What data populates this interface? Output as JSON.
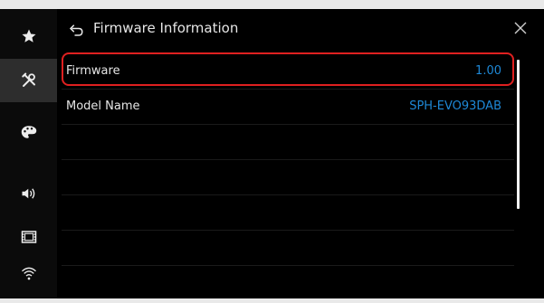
{
  "header": {
    "title": "Firmware Information"
  },
  "sidebar": {
    "items": [
      {
        "name": "favorites",
        "icon": "star-icon"
      },
      {
        "name": "settings",
        "icon": "tools-icon",
        "active": true
      },
      {
        "name": "theme",
        "icon": "palette-icon"
      },
      {
        "name": "audio",
        "icon": "speaker-icon"
      },
      {
        "name": "video",
        "icon": "film-icon"
      },
      {
        "name": "wireless",
        "icon": "wifi-icon"
      }
    ]
  },
  "rows": [
    {
      "label": "Firmware",
      "value": "1.00"
    },
    {
      "label": "Model Name",
      "value": "SPH-EVO93DAB"
    },
    {
      "label": "",
      "value": ""
    },
    {
      "label": "",
      "value": ""
    },
    {
      "label": "",
      "value": ""
    },
    {
      "label": "",
      "value": ""
    }
  ],
  "colors": {
    "value_text": "#1e88d6",
    "highlight": "#e02020",
    "active_sidebar": "#2d2d2d"
  }
}
